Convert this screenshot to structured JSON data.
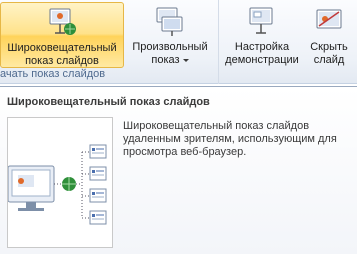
{
  "ribbon": {
    "left_group": {
      "label": "ачать показ слайдов",
      "broadcast_button": {
        "line1": "Широковещательный",
        "line2": "показ слайдов",
        "icon": "broadcast-slideshow-icon"
      },
      "custom_button": {
        "line1": "Произвольный",
        "line2": "показ",
        "icon": "custom-slideshow-icon",
        "has_dropdown": true
      }
    },
    "right_group": {
      "setup_button": {
        "line1": "Настройка",
        "line2": "демонстрации",
        "icon": "setup-slideshow-icon"
      },
      "hide_button": {
        "line1": "Скрыть",
        "line2": "слайд",
        "icon": "hide-slide-icon"
      }
    }
  },
  "tooltip": {
    "title": "Широковещательный показ слайдов",
    "description_lines": [
      "Широковещательный показ слайдов",
      "удаленным зрителям, использующим для",
      "просмотра веб-браузер."
    ],
    "illustration": "broadcast-network-diagram"
  },
  "colors": {
    "active_button": "#ffe28a",
    "ribbon_bg": "#eef2f8",
    "group_label": "#4f6a8f"
  }
}
